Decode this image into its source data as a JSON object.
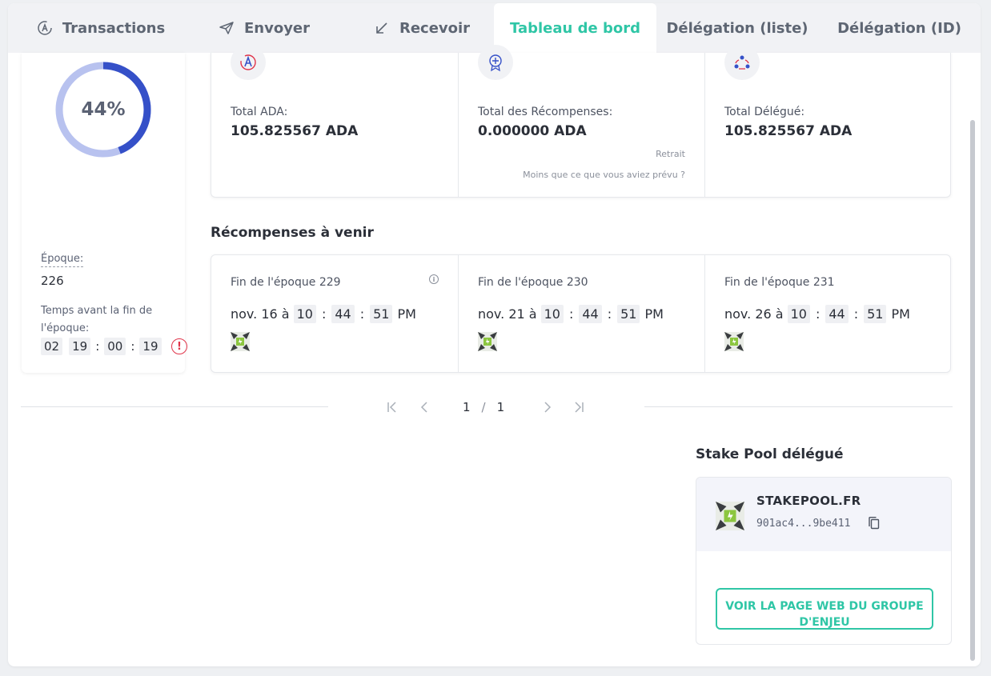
{
  "tabs": [
    {
      "label": "Transactions",
      "icon": "ada-icon"
    },
    {
      "label": "Envoyer",
      "icon": "send-icon"
    },
    {
      "label": "Recevoir",
      "icon": "receive-arrow-icon"
    },
    {
      "label": "Tableau de bord",
      "icon": ""
    },
    {
      "label": "Délégation (liste)",
      "icon": ""
    },
    {
      "label": "Délégation (ID)",
      "icon": ""
    }
  ],
  "active_tab": "Tableau de bord",
  "epoch": {
    "progress_label": "44%",
    "progress_fraction": 0.44,
    "epoch_label": "Époque:",
    "epoch_value": "226",
    "time_label": "Temps avant la fin de l'époque:",
    "countdown": [
      "02",
      "19",
      "00",
      "19"
    ],
    "warning_glyph": "!"
  },
  "summary": [
    {
      "label": "Total ADA:",
      "value": "105.825567 ADA",
      "icon": "ada-coin-icon"
    },
    {
      "label": "Total des Récompenses:",
      "value": "0.000000 ADA",
      "icon": "reward-medal-icon",
      "link1": "Retrait",
      "link2": "Moins que ce que vous aviez prévu ?"
    },
    {
      "label": "Total Délégué:",
      "value": "105.825567 ADA",
      "icon": "delegation-users-icon"
    }
  ],
  "upcoming": {
    "title": "Récompenses à venir",
    "items": [
      {
        "title": "Fin de l'époque 229",
        "prefix": "nov. 16 à",
        "time": [
          "10",
          "44",
          "51"
        ],
        "suffix": "PM",
        "info": "i"
      },
      {
        "title": "Fin de l'époque 230",
        "prefix": "nov. 21 à",
        "time": [
          "10",
          "44",
          "51"
        ],
        "suffix": "PM"
      },
      {
        "title": "Fin de l'époque 231",
        "prefix": "nov. 26 à",
        "time": [
          "10",
          "44",
          "51"
        ],
        "suffix": "PM"
      }
    ]
  },
  "pagination": {
    "current": "1",
    "separator": "/",
    "total": "1"
  },
  "stake_pool": {
    "title": "Stake Pool délégué",
    "name": "STAKEPOOL.FR",
    "id": "901ac4...9be411",
    "button": "VOIR LA PAGE WEB DU GROUPE D'ENJEU"
  },
  "colors": {
    "accent": "#2fc6a6",
    "donut_fill": "#3550c8",
    "donut_track": "#b8c2ef",
    "warning": "#e0344a"
  }
}
